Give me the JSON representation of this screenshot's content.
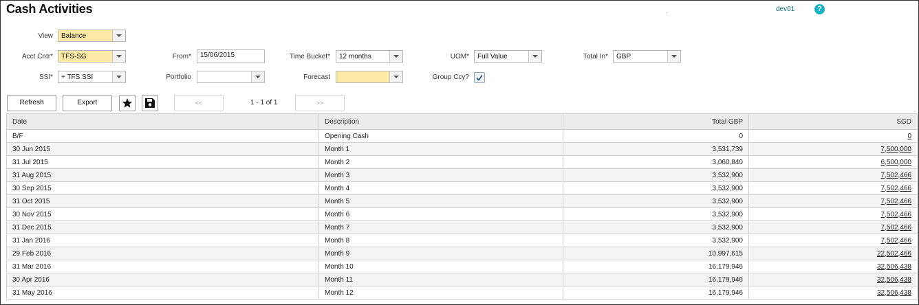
{
  "header": {
    "title": "Cash Activities",
    "dot": ".",
    "user": "dev01",
    "help": "?"
  },
  "filters": {
    "view": {
      "label": "View",
      "value": "Balance"
    },
    "acct_cntr": {
      "label": "Acct Cntr*",
      "value": "TFS-SG"
    },
    "ssi": {
      "label": "SSI*",
      "value": "+ TFS SSI"
    },
    "from": {
      "label": "From*",
      "value": "15/06/2015"
    },
    "portfolio": {
      "label": "Portfolio",
      "value": ""
    },
    "time_bucket": {
      "label": "Time Bucket*",
      "value": "12 months"
    },
    "forecast": {
      "label": "Forecast",
      "value": ""
    },
    "uom": {
      "label": "UOM*",
      "value": "Full Value"
    },
    "group_ccy": {
      "label": "Group Ccy?",
      "checked": true
    },
    "total_in": {
      "label": "Total In*",
      "value": "GBP"
    }
  },
  "toolbar": {
    "refresh": "Refresh",
    "export": "Export",
    "favorite_icon": "star-icon",
    "save_icon": "floppy-disk-icon",
    "prev": "<<",
    "page_info": "1 - 1 of 1",
    "next": ">>"
  },
  "table": {
    "columns": [
      "Date",
      "Description",
      "Total GBP",
      "SGD"
    ],
    "rows": [
      {
        "date": "B/F",
        "description": "Opening Cash",
        "total_gbp": "0",
        "sgd": "0"
      },
      {
        "date": "30 Jun 2015",
        "description": "Month 1",
        "total_gbp": "3,531,739",
        "sgd": "7,500,000"
      },
      {
        "date": "31 Jul 2015",
        "description": "Month 2",
        "total_gbp": "3,060,840",
        "sgd": "6,500,000"
      },
      {
        "date": "31 Aug 2015",
        "description": "Month 3",
        "total_gbp": "3,532,900",
        "sgd": "7,502,466"
      },
      {
        "date": "30 Sep 2015",
        "description": "Month 4",
        "total_gbp": "3,532,900",
        "sgd": "7,502,466"
      },
      {
        "date": "31 Oct 2015",
        "description": "Month 5",
        "total_gbp": "3,532,900",
        "sgd": "7,502,466"
      },
      {
        "date": "30 Nov 2015",
        "description": "Month 6",
        "total_gbp": "3,532,900",
        "sgd": "7,502,466"
      },
      {
        "date": "31 Dec 2015",
        "description": "Month 7",
        "total_gbp": "3,532,900",
        "sgd": "7,502,466"
      },
      {
        "date": "31 Jan 2016",
        "description": "Month 8",
        "total_gbp": "3,532,900",
        "sgd": "7,502,466"
      },
      {
        "date": "29 Feb 2016",
        "description": "Month 9",
        "total_gbp": "10,997,615",
        "sgd": "22,502,466"
      },
      {
        "date": "31 Mar 2016",
        "description": "Month 10",
        "total_gbp": "16,179,946",
        "sgd": "32,506,438"
      },
      {
        "date": "30 Apr 2016",
        "description": "Month 11",
        "total_gbp": "16,179,946",
        "sgd": "32,506,438"
      },
      {
        "date": "31 May 2016",
        "description": "Month 12",
        "total_gbp": "16,179,946",
        "sgd": "32,506,438"
      }
    ]
  }
}
